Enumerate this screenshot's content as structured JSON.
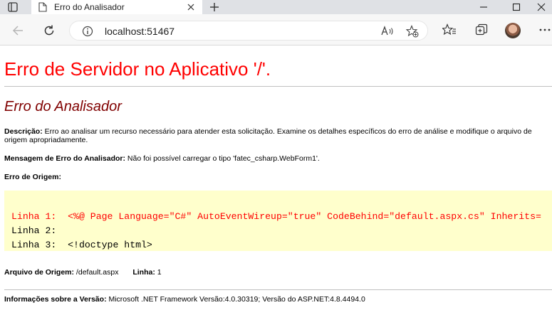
{
  "browser": {
    "tab_title": "Erro do Analisador",
    "url": "localhost:51467"
  },
  "page": {
    "title": "Erro de Servidor no Aplicativo '/'.",
    "subtitle": "Erro do Analisador",
    "description_label": "Descrição:",
    "description_text": " Erro ao analisar um recurso necessário para atender esta solicitação. Examine os detalhes específicos do erro de análise e modifique o arquivo de origem apropriadamente.",
    "parser_msg_label": "Mensagem de Erro do Analisador:",
    "parser_msg_text": " Não foi possível carregar o tipo 'fatec_csharp.WebForm1'.",
    "source_error_label": "Erro de Origem:",
    "code_lines": [
      {
        "prefix": "Linha 1:  ",
        "code": "<%@ Page Language=\"C#\" AutoEventWireup=\"true\" CodeBehind=\"default.aspx.cs\" Inherits="
      },
      {
        "prefix": "Linha 2:  ",
        "code": ""
      },
      {
        "prefix": "Linha 3:  ",
        "code": "<!doctype html>"
      }
    ],
    "source_file_label": "Arquivo de Origem:",
    "source_file_value": " /default.aspx",
    "line_label": "Linha:",
    "line_value": " 1",
    "version_label": "Informações sobre a Versão:",
    "version_text": " Microsoft .NET Framework Versão:4.0.30319; Versão do ASP.NET:4.8.4494.0"
  },
  "colors": {
    "title": "#ff0000",
    "subtitle": "#800000",
    "code_background": "#ffffcc"
  }
}
